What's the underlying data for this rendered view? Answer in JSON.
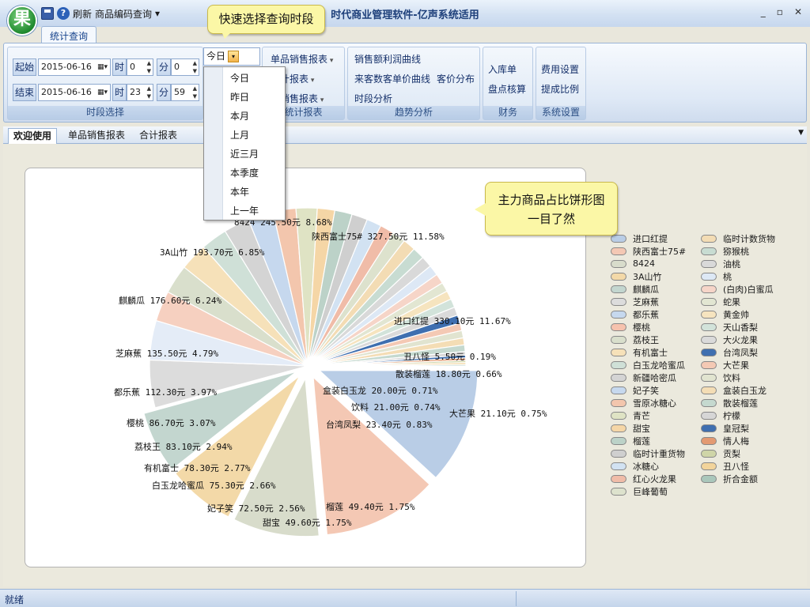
{
  "app": {
    "logo_text": "果",
    "title": "时代商业管理软件-亿声系统适用",
    "qa_refresh": "刷新",
    "qa_code_query": "商品编码查询",
    "qa_more": "▾",
    "win_min": "_",
    "win_max": "▫",
    "win_close": "✕"
  },
  "ribbon": {
    "tab": "统计查询",
    "callout": "快速选择查询时段",
    "period": {
      "start_label": "起始",
      "start_date": "2015-06-16",
      "start_hour_label": "时",
      "start_hour": "0",
      "start_min_label": "分",
      "start_min": "0",
      "end_label": "结束",
      "end_date": "2015-06-16",
      "end_hour_label": "时",
      "end_hour": "23",
      "end_min_label": "分",
      "end_min": "59",
      "preset_value": "今日",
      "group_label": "时段选择"
    },
    "preset_options": [
      "今日",
      "昨日",
      "本月",
      "上月",
      "近三月",
      "本季度",
      "本年",
      "上一年"
    ],
    "reports": {
      "item1": "单品销售报表",
      "item2": "统计报表",
      "item3": "类销售报表",
      "group_label": "统计报表"
    },
    "trend": {
      "item1": "销售额利润曲线",
      "item2": "来客数客单价曲线",
      "item3": "客价分布",
      "item4": "时段分析",
      "group_label": "趋势分析"
    },
    "finance": {
      "item1": "入库单",
      "item2": "盘点核算",
      "group_label": "财务"
    },
    "settings": {
      "item1": "费用设置",
      "item2": "提成比例",
      "group_label": "系统设置"
    }
  },
  "doc_tabs": [
    "欢迎使用",
    "单品销售报表",
    "合计报表"
  ],
  "callout2": {
    "line1": "主力商品占比饼形图",
    "line2": "一目了然"
  },
  "status": {
    "text": "就绪"
  },
  "chart_data": {
    "type": "pie",
    "title": "",
    "slices": [
      {
        "name": "进口红提",
        "value": 330.1,
        "pct": 11.67,
        "label": "进口红提 330.10元 11.67%",
        "color": "#b9cde6",
        "explode": true
      },
      {
        "name": "陕西富士75#",
        "value": 327.5,
        "pct": 11.58,
        "label": "陕西富士75# 327.50元 11.58%",
        "color": "#f4c8b4",
        "explode": true
      },
      {
        "name": "8424",
        "value": 245.5,
        "pct": 8.68,
        "label": "8424 245.50元 8.68%",
        "color": "#d8dccb",
        "explode": true
      },
      {
        "name": "3A山竹",
        "value": 193.7,
        "pct": 6.85,
        "label": "3A山竹 193.70元 6.85%",
        "color": "#f3d9a8",
        "explode": true
      },
      {
        "name": "麒麟瓜",
        "value": 176.6,
        "pct": 6.24,
        "label": "麒麟瓜 176.60元 6.24%",
        "color": "#c3d6cf",
        "explode": true
      },
      {
        "name": "芝麻蕉",
        "value": 135.5,
        "pct": 4.79,
        "label": "芝麻蕉 135.50元 4.79%",
        "color": "#dcdcdc"
      },
      {
        "name": "都乐蕉",
        "value": 112.3,
        "pct": 3.97,
        "label": "都乐蕉 112.30元 3.97%",
        "color": "#e4ecf7"
      },
      {
        "name": "樱桃",
        "value": 86.7,
        "pct": 3.07,
        "label": "樱桃 86.70元 3.07%",
        "color": "#f6d0c0"
      },
      {
        "name": "荔枝王",
        "value": 83.1,
        "pct": 2.94,
        "label": "荔枝王 83.10元 2.94%",
        "color": "#d9dfcc"
      },
      {
        "name": "有机富士",
        "value": 78.3,
        "pct": 2.77,
        "label": "有机富士 78.30元 2.77%",
        "color": "#f6e1b9"
      },
      {
        "name": "白玉龙哈蜜瓜",
        "value": 75.3,
        "pct": 2.66,
        "label": "白玉龙哈蜜瓜 75.30元 2.66%",
        "color": "#cfe0d7"
      },
      {
        "name": "新疆哈密瓜",
        "value": 73.0,
        "pct": 2.58,
        "label": "",
        "color": "#d4d4d4"
      },
      {
        "name": "妃子笑",
        "value": 72.5,
        "pct": 2.56,
        "label": "妃子笑 72.50元 2.56%",
        "color": "#c6d8ee"
      },
      {
        "name": "雪原冰糖心",
        "value": 65.0,
        "pct": 2.3,
        "label": "",
        "color": "#f3c6ad"
      },
      {
        "name": "青芒",
        "value": 60.0,
        "pct": 2.12,
        "label": "",
        "color": "#dfe3c4"
      },
      {
        "name": "甜宝",
        "value": 49.6,
        "pct": 1.75,
        "label": "甜宝 49.60元 1.75%",
        "color": "#f5d6a6"
      },
      {
        "name": "榴莲",
        "value": 49.4,
        "pct": 1.75,
        "label": "榴莲 49.40元 1.75%",
        "color": "#bcd2c8"
      },
      {
        "name": "临时计重货物",
        "value": 45.0,
        "pct": 1.59,
        "label": "",
        "color": "#cfcfcf"
      },
      {
        "name": "冰糖心",
        "value": 42.0,
        "pct": 1.48,
        "label": "",
        "color": "#d2e2f2"
      },
      {
        "name": "红心火龙果",
        "value": 40.0,
        "pct": 1.41,
        "label": "",
        "color": "#f0bca8"
      },
      {
        "name": "巨峰葡萄",
        "value": 38.0,
        "pct": 1.34,
        "label": "",
        "color": "#dde2cd"
      },
      {
        "name": "临时计数货物",
        "value": 36.0,
        "pct": 1.27,
        "label": "",
        "color": "#f3dcb4"
      },
      {
        "name": "猕猴桃",
        "value": 34.0,
        "pct": 1.2,
        "label": "",
        "color": "#c8dcd2"
      },
      {
        "name": "油桃",
        "value": 32.0,
        "pct": 1.13,
        "label": "",
        "color": "#d9d9d9"
      },
      {
        "name": "桃",
        "value": 30.0,
        "pct": 1.06,
        "label": "",
        "color": "#dde8f5"
      },
      {
        "name": "(白肉)白蜜瓜",
        "value": 28.0,
        "pct": 0.99,
        "label": "",
        "color": "#f6d5c8"
      },
      {
        "name": "蛇果",
        "value": 26.5,
        "pct": 0.94,
        "label": "",
        "color": "#e2e6d2"
      },
      {
        "name": "黄金帅",
        "value": 25.0,
        "pct": 0.88,
        "label": "",
        "color": "#f6e4bf"
      },
      {
        "name": "天山香梨",
        "value": 24.8,
        "pct": 0.88,
        "label": "",
        "color": "#d2e3da"
      },
      {
        "name": "大火龙果",
        "value": 24.0,
        "pct": 0.85,
        "label": "",
        "color": "#dadada"
      },
      {
        "name": "台湾凤梨",
        "value": 23.4,
        "pct": 0.83,
        "label": "台湾凤梨 23.40元 0.83%",
        "color": "#3f6fb0"
      },
      {
        "name": "大芒果",
        "value": 21.1,
        "pct": 0.75,
        "label": "大芒果 21.10元 0.75%",
        "color": "#f4c9b4"
      },
      {
        "name": "饮料",
        "value": 21.0,
        "pct": 0.74,
        "label": "饮料 21.00元 0.74%",
        "color": "#e1e4d0"
      },
      {
        "name": "盒装白玉龙",
        "value": 20.0,
        "pct": 0.71,
        "label": "盒装白玉龙 20.00元 0.71%",
        "color": "#f4ddb5"
      },
      {
        "name": "散装榴莲",
        "value": 18.8,
        "pct": 0.66,
        "label": "散装榴莲 18.80元 0.66%",
        "color": "#c5d9cf"
      },
      {
        "name": "柠檬",
        "value": 10.0,
        "pct": 0.35,
        "label": "",
        "color": "#d6d6d6"
      },
      {
        "name": "皇冠梨",
        "value": 8.0,
        "pct": 0.28,
        "label": "",
        "color": "#3f6fb0"
      },
      {
        "name": "情人梅",
        "value": 7.0,
        "pct": 0.25,
        "label": "",
        "color": "#e39a72"
      },
      {
        "name": "贡梨",
        "value": 6.0,
        "pct": 0.21,
        "label": "",
        "color": "#cfd5a8"
      },
      {
        "name": "丑八怪",
        "value": 5.5,
        "pct": 0.19,
        "label": "丑八怪 5.50元 0.19%",
        "color": "#f2d49b"
      },
      {
        "name": "折合金额",
        "value": 4.0,
        "pct": 0.14,
        "label": "",
        "color": "#aac7bb"
      }
    ]
  },
  "legend": [
    {
      "name": "进口红提",
      "color": "#b9cde6"
    },
    {
      "name": "陕西富士75#",
      "color": "#f4c8b4"
    },
    {
      "name": "8424",
      "color": "#d8dccb"
    },
    {
      "name": "3A山竹",
      "color": "#f3d9a8"
    },
    {
      "name": "麒麟瓜",
      "color": "#c3d6cf"
    },
    {
      "name": "芝麻蕉",
      "color": "#dcdcdc"
    },
    {
      "name": "都乐蕉",
      "color": "#c6d8ee"
    },
    {
      "name": "樱桃",
      "color": "#f6c2ae"
    },
    {
      "name": "荔枝王",
      "color": "#d9dfcc"
    },
    {
      "name": "有机富士",
      "color": "#f6e1b9"
    },
    {
      "name": "白玉龙哈蜜瓜",
      "color": "#cfe0d7"
    },
    {
      "name": "新疆哈密瓜",
      "color": "#d4d4d4"
    },
    {
      "name": "妃子笑",
      "color": "#c6d8ee"
    },
    {
      "name": "雪原冰糖心",
      "color": "#f3c6ad"
    },
    {
      "name": "青芒",
      "color": "#dfe3c4"
    },
    {
      "name": "甜宝",
      "color": "#f5d6a6"
    },
    {
      "name": "榴莲",
      "color": "#bcd2c8"
    },
    {
      "name": "临时计重货物",
      "color": "#cfcfcf"
    },
    {
      "name": "冰糖心",
      "color": "#d2e2f2"
    },
    {
      "name": "红心火龙果",
      "color": "#f0bca8"
    },
    {
      "name": "巨峰葡萄",
      "color": "#dde2cd"
    },
    {
      "name": "临时计数货物",
      "color": "#f3dcb4"
    },
    {
      "name": "猕猴桃",
      "color": "#c8dcd2"
    },
    {
      "name": "油桃",
      "color": "#d9d9d9"
    },
    {
      "name": "桃",
      "color": "#dde8f5"
    },
    {
      "name": "(白肉)白蜜瓜",
      "color": "#f6d5c8"
    },
    {
      "name": "蛇果",
      "color": "#e2e6d2"
    },
    {
      "name": "黄金帅",
      "color": "#f6e4bf"
    },
    {
      "name": "天山香梨",
      "color": "#d2e3da"
    },
    {
      "name": "大火龙果",
      "color": "#dadada"
    },
    {
      "name": "台湾凤梨",
      "color": "#3f6fb0"
    },
    {
      "name": "大芒果",
      "color": "#f4c9b4"
    },
    {
      "name": "饮料",
      "color": "#e1e4d0"
    },
    {
      "name": "盒装白玉龙",
      "color": "#f4ddb5"
    },
    {
      "name": "散装榴莲",
      "color": "#c5d9cf"
    },
    {
      "name": "柠檬",
      "color": "#d6d6d6"
    },
    {
      "name": "皇冠梨",
      "color": "#3f6fb0"
    },
    {
      "name": "情人梅",
      "color": "#e39a72"
    },
    {
      "name": "贡梨",
      "color": "#cfd5a8"
    },
    {
      "name": "丑八怪",
      "color": "#f2d49b"
    },
    {
      "name": "折合金额",
      "color": "#aac7bb"
    }
  ]
}
